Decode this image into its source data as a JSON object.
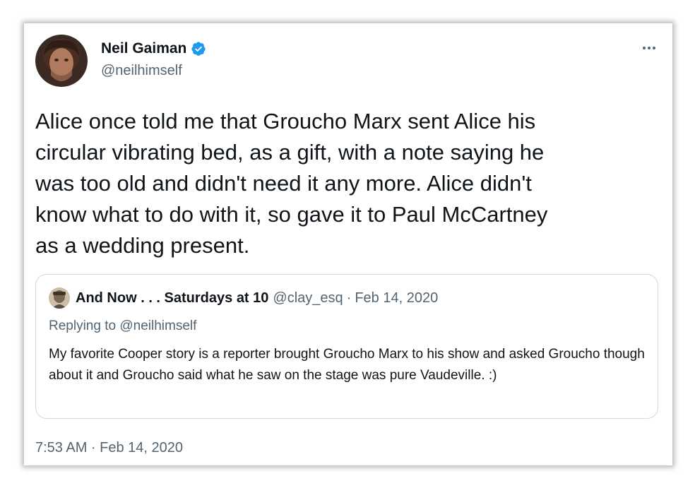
{
  "tweet": {
    "author_name": "Neil Gaiman",
    "author_handle": "@neilhimself",
    "text": "Alice once told me that Groucho Marx sent Alice his\ncircular vibrating bed, as a gift, with a note saying he\nwas too old and didn't need it any more. Alice didn't\nknow what to do with it, so gave it to Paul McCartney\nas a wedding present.",
    "timestamp": "7:53 AM · Feb 14, 2020"
  },
  "quoted": {
    "author_name": "And Now . . . Saturdays at 10",
    "author_handle": "@clay_esq",
    "separator": "·",
    "date": "Feb 14, 2020",
    "replying_to_label": "Replying to",
    "replying_to_handle": "@neilhimself",
    "text": "My favorite Cooper story is a reporter brought Groucho Marx to his show and asked Groucho though about it and Groucho said what he saw on the stage was pure Vaudeville. :)"
  },
  "icons": {
    "verified": "verified-badge-icon",
    "more": "more-options-icon"
  },
  "colors": {
    "verified_blue": "#1d9bf0",
    "text_primary": "#0f1419",
    "text_secondary": "#536471",
    "border": "#cfd9de"
  }
}
